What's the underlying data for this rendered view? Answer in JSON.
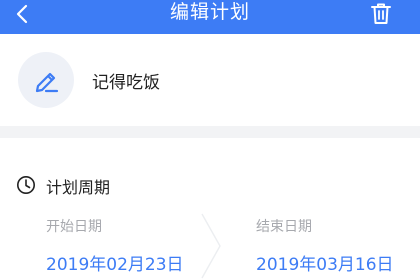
{
  "header": {
    "title": "编辑计划",
    "back_icon": "chevron-left-icon",
    "delete_icon": "trash-icon",
    "background_color": "#3d7cf5"
  },
  "task": {
    "name": "记得吃饭",
    "icon": "pencil-icon",
    "icon_color": "#3d7cf5"
  },
  "plan_period": {
    "title": "计划周期",
    "icon": "clock-icon",
    "start_label": "开始日期",
    "start_date": "2019年02月23日",
    "end_label": "结束日期",
    "end_date": "2019年03月16日",
    "date_color": "#3d7cf5"
  }
}
